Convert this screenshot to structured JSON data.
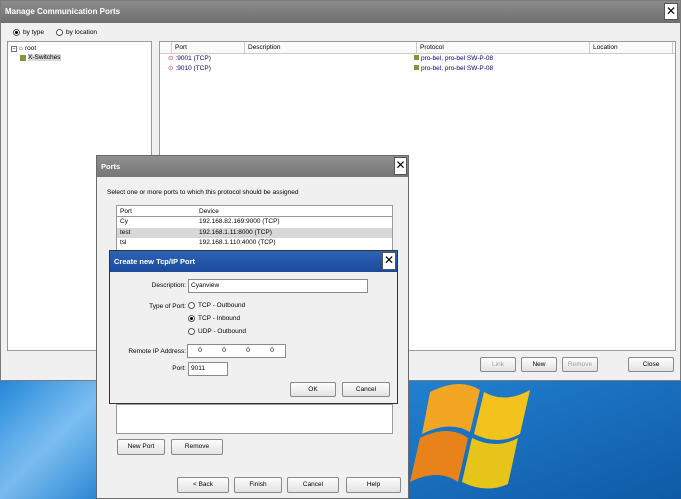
{
  "main_window": {
    "title": "Manage Communication Ports",
    "view_options": [
      {
        "label": "by type",
        "selected": true
      },
      {
        "label": "by location",
        "selected": false
      }
    ],
    "tree": {
      "root_label": "root",
      "child_label": "X-Switches"
    },
    "columns": [
      "Port",
      "Description",
      "Protocol",
      "Location"
    ],
    "rows": [
      {
        "port": ":9001 (TCP)",
        "protocol": "pro-bel, pro-bel SW-P-08"
      },
      {
        "port": ":9010 (TCP)",
        "protocol": "pro-bel, pro-bel SW-P-08"
      }
    ],
    "buttons": {
      "link": "Link",
      "new": "New",
      "remove": "Remove",
      "close": "Close"
    }
  },
  "ports_dialog": {
    "title": "Ports",
    "instruction": "Select one or more ports to which this protocol should be assigned",
    "columns": [
      "Port",
      "Device"
    ],
    "rows": [
      {
        "port": "Cy",
        "device": "192.168.82.169:9000 (TCP)"
      },
      {
        "port": "test",
        "device": "192.168.1.11:8000 (TCP)"
      },
      {
        "port": "tsl",
        "device": "192.168.1.110:4000 (TCP)"
      }
    ],
    "buttons": {
      "new_port": "New Port",
      "remove": "Remove",
      "back": "< Back",
      "finish": "Finish",
      "cancel": "Cancel",
      "help": "Help"
    }
  },
  "tcp_dialog": {
    "title": "Create new Tcp/IP Port",
    "description_label": "Description:",
    "description_value": "Cyanview",
    "type_label": "Type of Port:",
    "types": [
      {
        "label": "TCP - Outbound",
        "selected": false
      },
      {
        "label": "TCP - Inbound",
        "selected": true
      },
      {
        "label": "UDP - Outbound",
        "selected": false
      }
    ],
    "remote_ip_label": "Remote IP Address:",
    "remote_ip": [
      "0",
      "0",
      "0",
      "0"
    ],
    "port_label": "Port:",
    "port_value": "9011",
    "ok": "OK",
    "cancel": "Cancel"
  },
  "colors": {
    "title_gray": "#777777",
    "title_blue": "#1f52a4",
    "list_link_text": "#000080"
  }
}
